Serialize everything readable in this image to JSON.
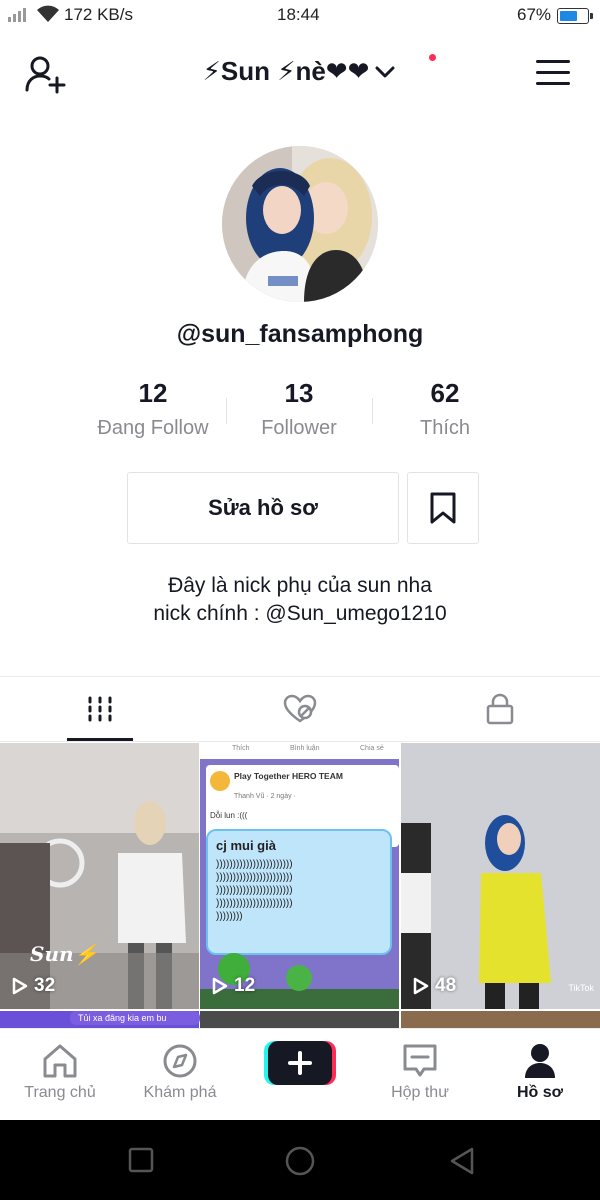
{
  "status_bar": {
    "network_speed": "172 KB/s",
    "time": "18:44",
    "battery_percent": "67%",
    "battery_level": 0.67
  },
  "header": {
    "account_name": "⚡Sun ⚡nè❤❤",
    "notification_dot": true
  },
  "profile": {
    "handle": "@sun_fansamphong",
    "stats": [
      {
        "value": "12",
        "label": "Đang Follow"
      },
      {
        "value": "13",
        "label": "Follower"
      },
      {
        "value": "62",
        "label": "Thích"
      }
    ],
    "edit_button": "Sửa hồ sơ",
    "bio_lines": [
      "Đây là nick phụ của sun nha",
      "nick chính : @Sun_umego1210"
    ]
  },
  "tabs": [
    {
      "icon": "grid-icon",
      "active": true
    },
    {
      "icon": "liked-hidden-icon",
      "active": false
    },
    {
      "icon": "lock-icon",
      "active": false
    }
  ],
  "videos": [
    {
      "views": "32",
      "watermark": "Sun⚡"
    },
    {
      "views": "12",
      "fb_actions": [
        "Thích",
        "Bình luận",
        "Chia sẻ"
      ],
      "fb_page": "Play Together HERO TEAM",
      "fb_author": "Thanh Vũ · 2 ngày ·",
      "fb_caption": "Dỗi lun :(((",
      "bubble_title": "cj mui già",
      "bubble_lines": [
        ")))))))))))))))))))))))",
        ")))))))))))))))))))))))",
        ")))))))))))))))))))))))",
        ")))))))))))))))))))))))",
        "))))))))"
      ]
    },
    {
      "views": "48",
      "watermark": "TikTok"
    }
  ],
  "row2_text": "Tủi xa đâng kia em bu",
  "bottom_nav": [
    {
      "label": "Trang chủ",
      "icon": "home-icon",
      "active": false
    },
    {
      "label": "Khám phá",
      "icon": "compass-icon",
      "active": false
    },
    {
      "label": "",
      "icon": "plus-icon",
      "active": false
    },
    {
      "label": "Hộp thư",
      "icon": "inbox-icon",
      "active": false
    },
    {
      "label": "Hồ sơ",
      "icon": "profile-icon",
      "active": true
    }
  ],
  "colors": {
    "accent_pink": "#fe2c55",
    "accent_cyan": "#25f4ee",
    "text_primary": "#161823",
    "text_secondary": "#8a8b91"
  }
}
